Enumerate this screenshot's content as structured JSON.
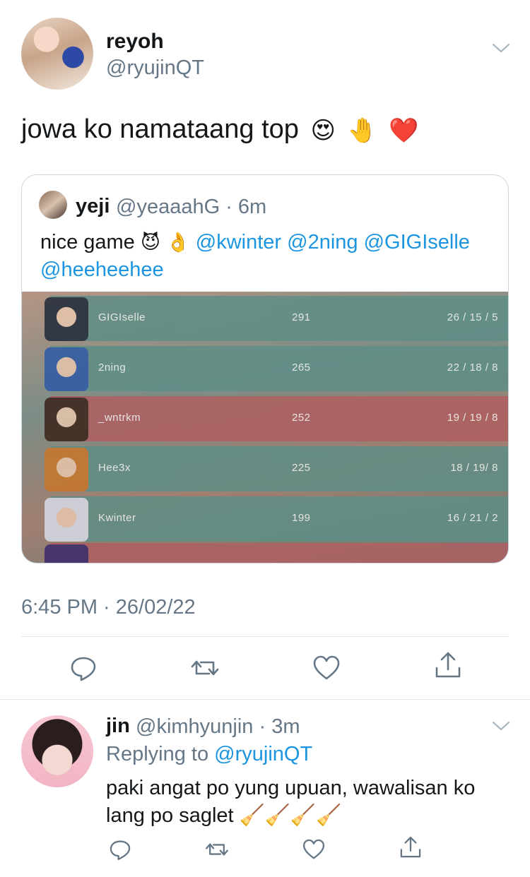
{
  "tweet": {
    "display_name": "reyoh",
    "handle": "@ryujinQT",
    "text": "jowa ko namataang top",
    "emojis": [
      "😍",
      "🤚",
      "❤️"
    ],
    "timestamp": "6:45 PM · 26/02/22"
  },
  "quote": {
    "display_name": "yeji",
    "handle": "@yeaaahG",
    "time": "6m",
    "text_prefix": "nice game",
    "emojis": [
      "😈",
      "👌"
    ],
    "mentions_line1": "@kwinter @2ning @GIGIselle",
    "mentions_line2": "@heeheehee",
    "scoreboard": {
      "rows": [
        {
          "name": "GIGIselle",
          "score": "291",
          "kda": "26 / 15 / 5",
          "team_color": "#5f8e86"
        },
        {
          "name": "2ning",
          "score": "265",
          "kda": "22 / 18 / 8",
          "team_color": "#5f8e86"
        },
        {
          "name": "_wntrkm",
          "score": "252",
          "kda": "19 / 19 / 8",
          "team_color": "#b05f60"
        },
        {
          "name": "Hee3x",
          "score": "225",
          "kda": "18 / 19/ 8",
          "team_color": "#5f8e86"
        },
        {
          "name": "Kwinter",
          "score": "199",
          "kda": "16 / 21 / 2",
          "team_color": "#5f8e86"
        }
      ]
    }
  },
  "actions": {
    "reply_icon": "comment-icon",
    "retweet_icon": "retweet-icon",
    "like_icon": "heart-icon",
    "share_icon": "share-icon"
  },
  "reply": {
    "display_name": "jin",
    "handle": "@kimhyunjin",
    "time": "3m",
    "replying_prefix": "Replying to",
    "replying_to": "@ryujinQT",
    "text": "paki angat po yung upuan, wawalisan ko lang po saglet",
    "emojis": [
      "🧹",
      "🧹",
      "🧹",
      "🧹"
    ]
  },
  "colors": {
    "link": "#1b95e0",
    "secondary_text": "#657786",
    "border": "#e1e8ed"
  }
}
